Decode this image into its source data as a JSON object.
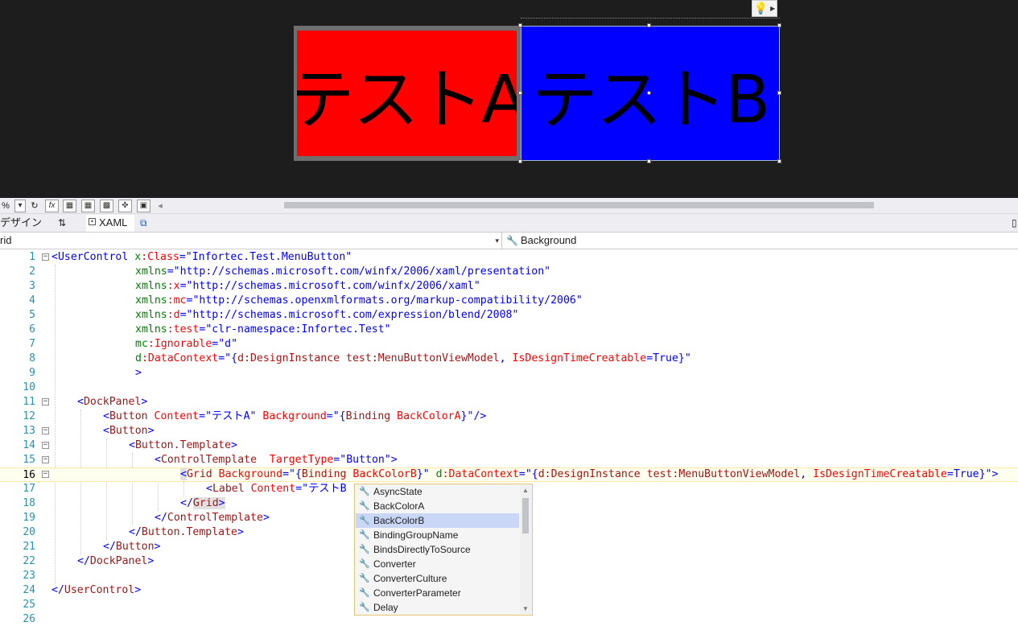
{
  "designer": {
    "button_a_label": "テストA",
    "button_b_label": "テストB",
    "button_a_color": "#ff0000",
    "button_b_color": "#0000ff",
    "lightbulb_icon": "lightbulb-icon"
  },
  "toolbar": {
    "zoom_value": "%",
    "fx_label": "fx"
  },
  "tabs": {
    "design": "デザイン",
    "swap": "⇅",
    "xaml": "XAML",
    "popout_icon": "popout-icon"
  },
  "navbar": {
    "left_value": "rid",
    "right_value": "Background"
  },
  "editor": {
    "current_line": 16,
    "line_numbers": [
      "1",
      "2",
      "3",
      "4",
      "5",
      "6",
      "7",
      "8",
      "9",
      "10",
      "11",
      "12",
      "13",
      "14",
      "15",
      "16",
      "17",
      "18",
      "19",
      "20",
      "21",
      "22",
      "23",
      "24",
      "25",
      "26"
    ],
    "l1": {
      "tag": "<UserControl",
      "a": "x",
      "b": ":Class",
      "c": "=\"Infortec.Test.MenuButton\""
    },
    "l2": {
      "a": "xmlns",
      "c": "=\"http://schemas.microsoft.com/winfx/2006/xaml/presentation\""
    },
    "l3": {
      "a": "xmlns",
      "b": ":x",
      "c": "=\"http://schemas.microsoft.com/winfx/2006/xaml\""
    },
    "l4": {
      "a": "xmlns",
      "b": ":mc",
      "c": "=\"http://schemas.openxmlformats.org/markup-compatibility/2006\""
    },
    "l5": {
      "a": "xmlns",
      "b": ":d",
      "c": "=\"http://schemas.microsoft.com/expression/blend/2008\""
    },
    "l6": {
      "a": "xmlns",
      "b": ":test",
      "c": "=\"clr-namespace:Infortec.Test\""
    },
    "l7": {
      "a": "mc",
      "b": ":Ignorable",
      "c": "=\"d\""
    },
    "l8": {
      "a": "d",
      "b": ":DataContext",
      "c": "=\"{",
      "d": "d",
      "e": ":DesignInstance",
      "f": " test",
      "g": ":MenuButtonViewModel",
      "h": ",",
      "i": " IsDesignTimeCreatable",
      "j": "=True}\""
    },
    "l9": {
      "c": ">"
    },
    "l11": {
      "open": "<",
      "tag": "DockPanel",
      "close": ">"
    },
    "l12": {
      "open": "<",
      "tag": "Button",
      "a1": " Content",
      "v1": "=\"テストA\"",
      "a2": " Background",
      "v2": "=\"{",
      "m1": "Binding",
      "m2": " BackColorA",
      "v3": "}\"",
      "close": "/>"
    },
    "l13": {
      "open": "<",
      "tag": "Button",
      "close": ">"
    },
    "l14": {
      "open": "<",
      "tag": "Button.Template",
      "close": ">"
    },
    "l15": {
      "open": "<",
      "tag": "ControlTemplate",
      "a1": "  TargetType",
      "v1": "=\"Button\"",
      "close": ">"
    },
    "l16": {
      "open": "<",
      "tag": "Grid",
      "a1": " Background",
      "v1": "=\"{",
      "m1": "Binding",
      "m2": " BackColorB",
      "v2": "}\"",
      "a2": " d",
      "a3": ":DataContext",
      "v3": "=\"{",
      "m3": "d",
      "m4": ":DesignInstance",
      "m5": " test",
      "m6": ":MenuButtonViewModel",
      "v4": ",",
      "m7": " IsDesignTimeCreatable",
      "v5": "=True}\"",
      "close": ">"
    },
    "l17": {
      "open": "<",
      "tag": "Label",
      "a1": " Content",
      "v1": "=\"テストB"
    },
    "l18": {
      "open": "</",
      "tag": "Grid",
      "close": ">"
    },
    "l19": {
      "open": "</",
      "tag": "ControlTemplate",
      "close": ">"
    },
    "l20": {
      "open": "</",
      "tag": "Button.Template",
      "close": ">"
    },
    "l21": {
      "open": "</",
      "tag": "Button",
      "close": ">"
    },
    "l22": {
      "open": "</",
      "tag": "DockPanel",
      "close": ">"
    },
    "l24": {
      "open": "</",
      "tag": "UserControl",
      "close": ">"
    }
  },
  "intellisense": {
    "items": [
      "AsyncState",
      "BackColorA",
      "BackColorB",
      "BindingGroupName",
      "BindsDirectlyToSource",
      "Converter",
      "ConverterCulture",
      "ConverterParameter",
      "Delay"
    ],
    "selected": "BackColorB"
  }
}
